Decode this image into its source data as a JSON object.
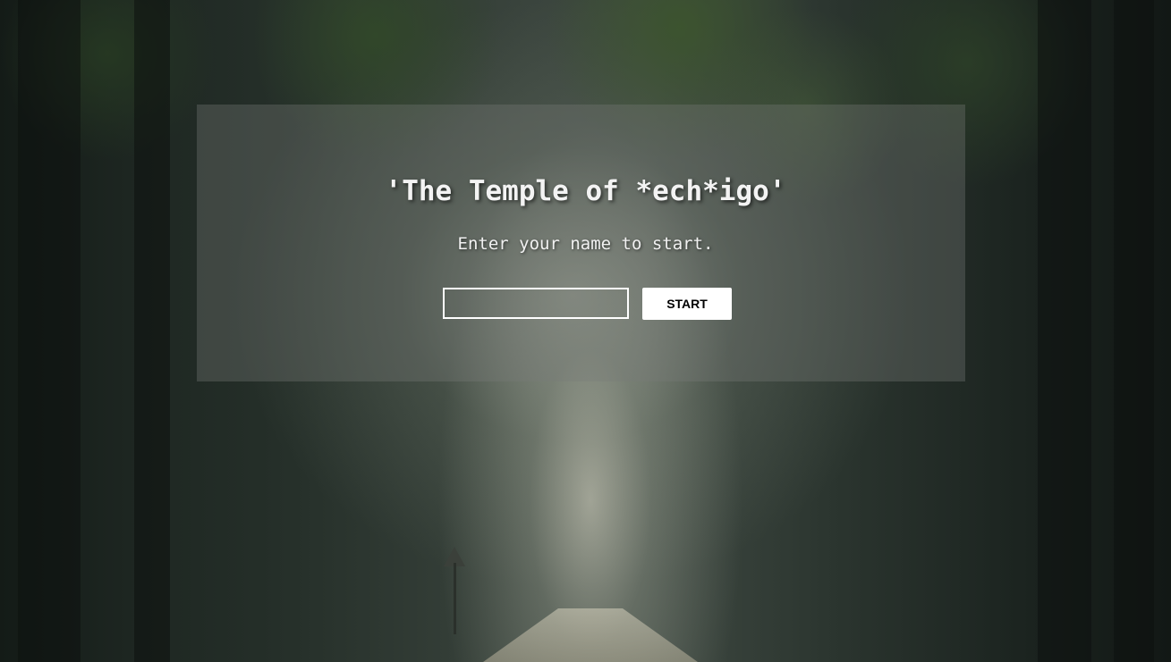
{
  "page": {
    "title": "'The Temple of *ech*igo'",
    "subtitle": "Enter your name to start."
  },
  "form": {
    "name_input_value": "",
    "name_input_placeholder": "",
    "start_label": "START"
  },
  "colors": {
    "panel_overlay": "#787a78",
    "text": "#f3f3f3",
    "button_bg": "#ffffff",
    "button_text": "#000000"
  },
  "background": {
    "description_icon": "forest-road-background"
  }
}
